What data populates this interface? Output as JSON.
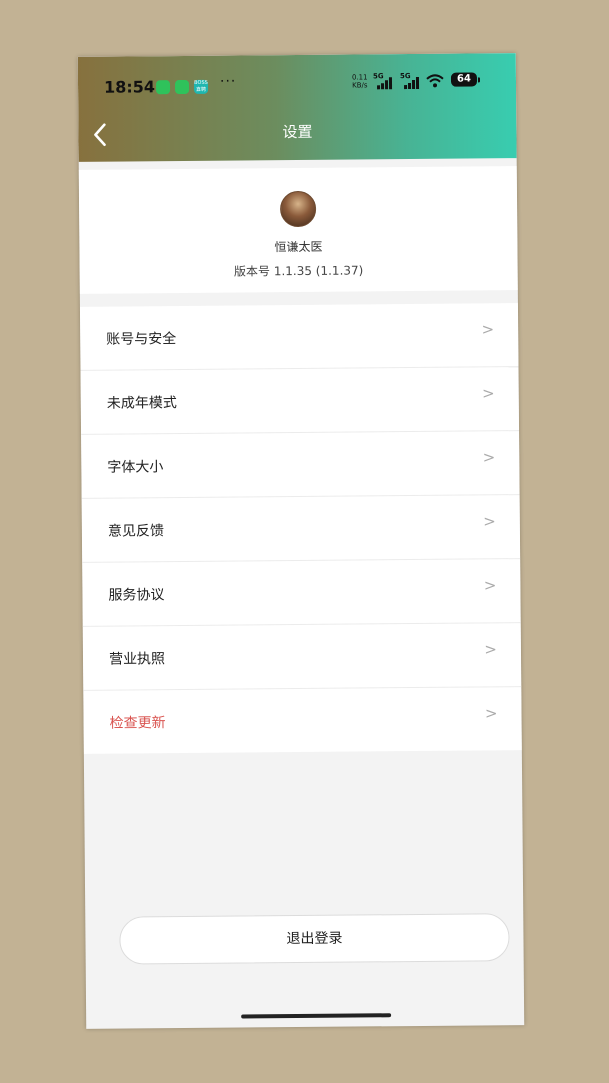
{
  "status_bar": {
    "time": "18:54",
    "boss_icon_text": "BOSS直聘",
    "more": "···",
    "net_speed_value": "0.11",
    "net_speed_unit": "KB/s",
    "signal1_label": "5G",
    "signal2_label": "5G",
    "battery": "64"
  },
  "header": {
    "title": "设置",
    "back_icon": "chevron-left-icon"
  },
  "profile": {
    "name": "恒谦太医",
    "version": "版本号 1.1.35 (1.1.37)"
  },
  "menu": {
    "items": [
      {
        "label": "账号与安全",
        "chevron": ">"
      },
      {
        "label": "未成年模式",
        "chevron": ">"
      },
      {
        "label": "字体大小",
        "chevron": ">"
      },
      {
        "label": "意见反馈",
        "chevron": ">"
      },
      {
        "label": "服务协议",
        "chevron": ">"
      },
      {
        "label": "营业执照",
        "chevron": ">"
      },
      {
        "label": "检查更新",
        "chevron": ">"
      }
    ]
  },
  "logout_label": "退出登录",
  "colors": {
    "accent_red": "#d9534f",
    "header_start": "#87713e",
    "header_end": "#38cdb0"
  }
}
